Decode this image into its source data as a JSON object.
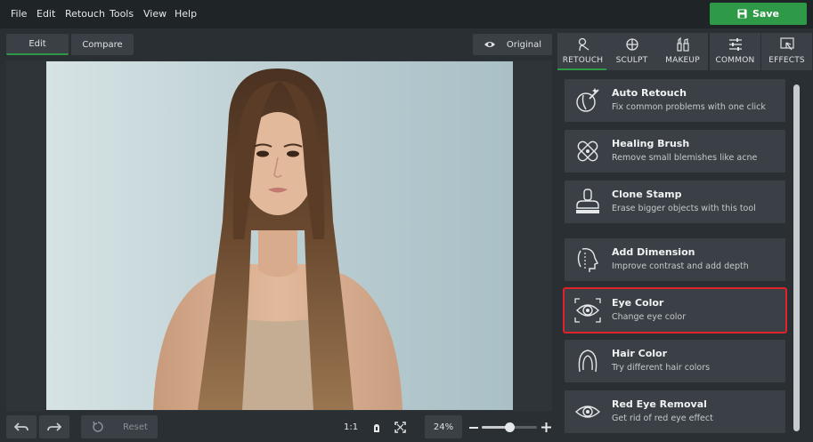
{
  "menu": {
    "items": [
      "File",
      "Edit",
      "Retouch",
      "Tools",
      "View",
      "Help"
    ]
  },
  "save_button": {
    "label": "Save"
  },
  "view_tabs": {
    "edit": "Edit",
    "compare": "Compare",
    "original": "Original"
  },
  "bottom": {
    "reset": "Reset",
    "zoom_ratio": "1:1",
    "zoom_percent": "24%",
    "zoom_slider_value": 0.5
  },
  "categories": [
    {
      "label": "RETOUCH",
      "icon": "retouch-icon"
    },
    {
      "label": "SCULPT",
      "icon": "sculpt-icon"
    },
    {
      "label": "MAKEUP",
      "icon": "makeup-icon"
    },
    {
      "label": "COMMON",
      "icon": "sliders-icon"
    },
    {
      "label": "EFFECTS",
      "icon": "effects-icon"
    }
  ],
  "tools": [
    {
      "title": "Auto Retouch",
      "desc": "Fix common problems with one click",
      "icon": "auto-retouch-icon"
    },
    {
      "title": "Healing Brush",
      "desc": "Remove small blemishes like acne",
      "icon": "bandage-icon"
    },
    {
      "title": "Clone Stamp",
      "desc": "Erase bigger objects with this tool",
      "icon": "stamp-icon"
    },
    {
      "title": "Add Dimension",
      "desc": "Improve contrast and add depth",
      "icon": "face-dimension-icon"
    },
    {
      "title": "Eye Color",
      "desc": "Change eye color",
      "icon": "eye-target-icon"
    },
    {
      "title": "Hair Color",
      "desc": "Try different hair colors",
      "icon": "hair-icon"
    },
    {
      "title": "Red Eye Removal",
      "desc": "Get rid of red eye effect",
      "icon": "eye-icon"
    }
  ],
  "colors": {
    "accent": "#2e9a47",
    "highlight": "#e0222b",
    "panel": "#3a4045"
  }
}
